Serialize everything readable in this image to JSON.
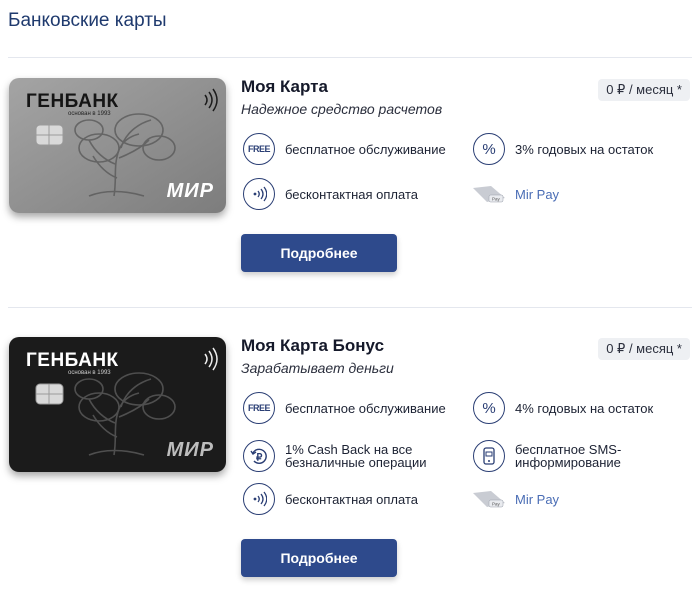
{
  "page": {
    "title": "Банковские карты"
  },
  "cards": [
    {
      "bank_logo": "ГЕНБАНК",
      "logo_sub": "основан в 1993",
      "payment_system": "МИР",
      "card_color": "#8e8e8e",
      "name": "Моя Карта",
      "subtitle": "Надежное средство расчетов",
      "price": "0 ₽ / месяц *",
      "features": [
        {
          "icon": "free-icon",
          "text": "бесплатное обслуживание"
        },
        {
          "icon": "percent-icon",
          "text": "3% годовых на остаток"
        },
        {
          "icon": "contactless-icon",
          "text": "бесконтактная оплата"
        },
        {
          "icon": "mir-pay-icon",
          "text": "Mir Pay"
        }
      ],
      "button_label": "Подробнее"
    },
    {
      "bank_logo": "ГЕНБАНК",
      "logo_sub": "основан в 1993",
      "payment_system": "МИР",
      "card_color": "#1b1b1b",
      "name": "Моя Карта Бонус",
      "subtitle": "Зарабатывает деньги",
      "price": "0 ₽ / месяц *",
      "features": [
        {
          "icon": "free-icon",
          "text": "бесплатное обслуживание"
        },
        {
          "icon": "percent-icon",
          "text": "4% годовых на остаток"
        },
        {
          "icon": "cashback-icon",
          "text": "1% Cash Back на все безналичные операции"
        },
        {
          "icon": "sms-icon",
          "text": "бесплатное SMS-информирование"
        },
        {
          "icon": "contactless-icon",
          "text": "бесконтактная оплата"
        },
        {
          "icon": "mir-pay-icon",
          "text": "Mir Pay"
        }
      ],
      "button_label": "Подробнее"
    }
  ],
  "colors": {
    "accent": "#2e4a8c",
    "title": "#1f3a6e",
    "badge_bg": "#eef0f3",
    "mir_pay": "#4a6db5"
  }
}
